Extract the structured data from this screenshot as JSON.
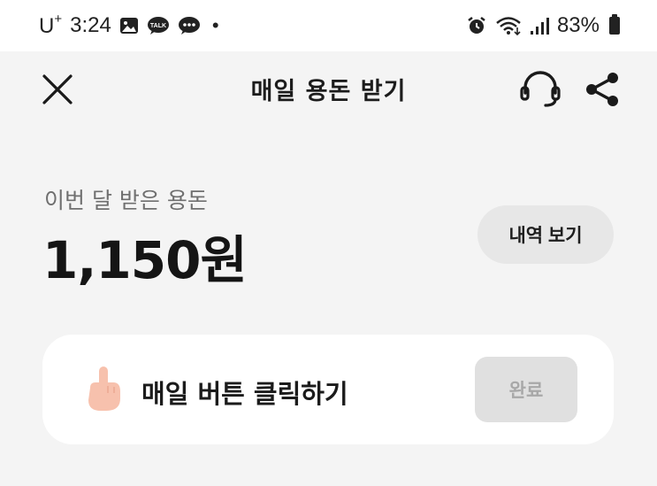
{
  "status_bar": {
    "carrier": "U",
    "carrier_sup": "+",
    "time": "3:24",
    "notification_icons": [
      "gallery-icon",
      "kakaotalk-icon",
      "chat-bubble-icon"
    ],
    "right_icons": [
      "alarm-icon",
      "wifi-icon",
      "signal-icon",
      "battery-icon"
    ],
    "battery_percent": "83%"
  },
  "header": {
    "title": "매일 용돈 받기",
    "left_icon": "close-icon",
    "right_icons": [
      "headset-icon",
      "share-icon"
    ]
  },
  "summary": {
    "label": "이번 달 받은 용돈",
    "amount": "1,150원",
    "history_button": "내역 보기"
  },
  "mission": {
    "icon": "pointing-hand-icon",
    "label": "매일 버튼 클릭하기",
    "button": "완료",
    "completed": true
  },
  "colors": {
    "background": "#f4f4f4",
    "card": "#ffffff",
    "history_button_bg": "#e7e7e7",
    "done_button_bg": "#e0e0e0",
    "done_button_text": "#a8a8a8",
    "hand_skin": "#f7c1ad"
  }
}
